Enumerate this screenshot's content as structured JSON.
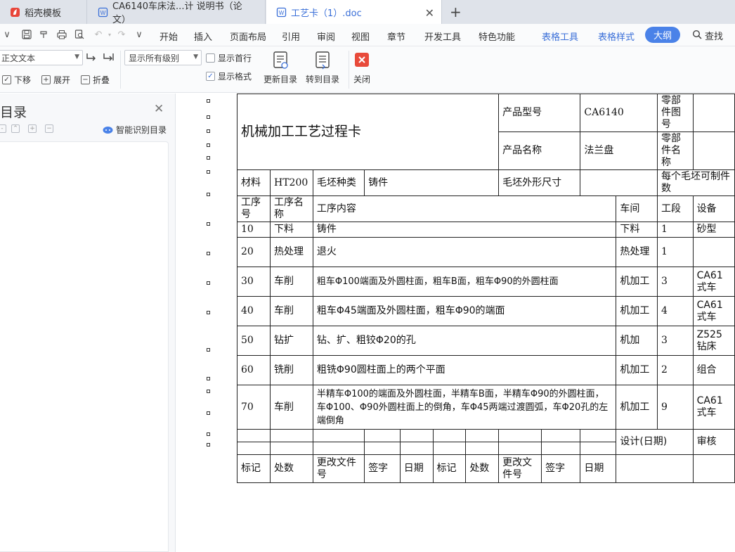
{
  "tabs": [
    {
      "label": "稻壳模板"
    },
    {
      "label": "CA6140车床法...计 说明书（论文）"
    },
    {
      "label": "工艺卡（1）.doc"
    }
  ],
  "menu": {
    "items": [
      "开始",
      "插入",
      "页面布局",
      "引用",
      "审阅",
      "视图",
      "章节",
      "开发工具",
      "特色功能"
    ],
    "context_items": [
      "表格工具",
      "表格样式"
    ],
    "active": "大纲",
    "search": "查找"
  },
  "toolbar": {
    "style_combo": "正文文本",
    "level_combo": "显示所有级别",
    "show_first_line": "显示首行",
    "show_format": "显示格式",
    "update_toc": "更新目录",
    "goto_toc": "转到目录",
    "close": "关闭",
    "move_down": "下移",
    "expand": "展开",
    "collapse": "折叠"
  },
  "panel": {
    "title": "目录",
    "smart_toc": "智能识别目录"
  },
  "card": {
    "title": "机械加工工艺过程卡",
    "product_model_label": "产品型号",
    "product_model": "CA6140",
    "part_drawing_label": "零部件图号",
    "product_name_label": "产品名称",
    "product_name": "法兰盘",
    "part_name_label": "零部件名称",
    "material_label": "材料",
    "material": "HT200",
    "blank_type_label": "毛坯种类",
    "blank_type": "铸件",
    "blank_size_label": "毛坯外形尺寸",
    "per_blank_label": "每个毛坯可制件数",
    "headers": [
      "工序号",
      "工序名称",
      "工序内容",
      "车间",
      "工段",
      "设备"
    ],
    "rows": [
      {
        "no": "10",
        "name": "下料",
        "content": "铸件",
        "shop": "下料",
        "section": "1",
        "equipment": "砂型"
      },
      {
        "no": "20",
        "name": "热处理",
        "content": "退火",
        "shop": "热处理",
        "section": "1",
        "equipment": ""
      },
      {
        "no": "30",
        "name": "车削",
        "content": "粗车Φ100端面及外圆柱面，粗车B面，粗车Φ90的外圆柱面",
        "shop": "机加工",
        "section": "3",
        "equipment": "CA61式车"
      },
      {
        "no": "40",
        "name": "车削",
        "content": "粗车Φ45端面及外圆柱面，粗车Φ90的端面",
        "shop": "机加工",
        "section": "4",
        "equipment": "CA61式车"
      },
      {
        "no": "50",
        "name": "钻扩",
        "content": "钻、扩、粗铰Φ20的孔",
        "shop": "机加",
        "section": "3",
        "equipment": "Z525钻床"
      },
      {
        "no": "60",
        "name": "铣削",
        "content": "粗铣Φ90圆柱面上的两个平面",
        "shop": "机加工",
        "section": "2",
        "equipment": "组合"
      },
      {
        "no": "70",
        "name": "车削",
        "content": "半精车Φ100的端面及外圆柱面，半精车B面，半精车Φ90的外圆柱面，车Φ100、Φ90外圆柱面上的倒角，车Φ45两端过渡圆弧，车Φ20孔的左端倒角",
        "shop": "机加工",
        "section": "9",
        "equipment": "CA61式车"
      }
    ],
    "design_date": "设计(日期)",
    "review": "审核",
    "footer": [
      "标记",
      "处数",
      "更改文件号",
      "签字",
      "日期",
      "标记",
      "处数",
      "更改文件号",
      "签字",
      "日期"
    ]
  }
}
